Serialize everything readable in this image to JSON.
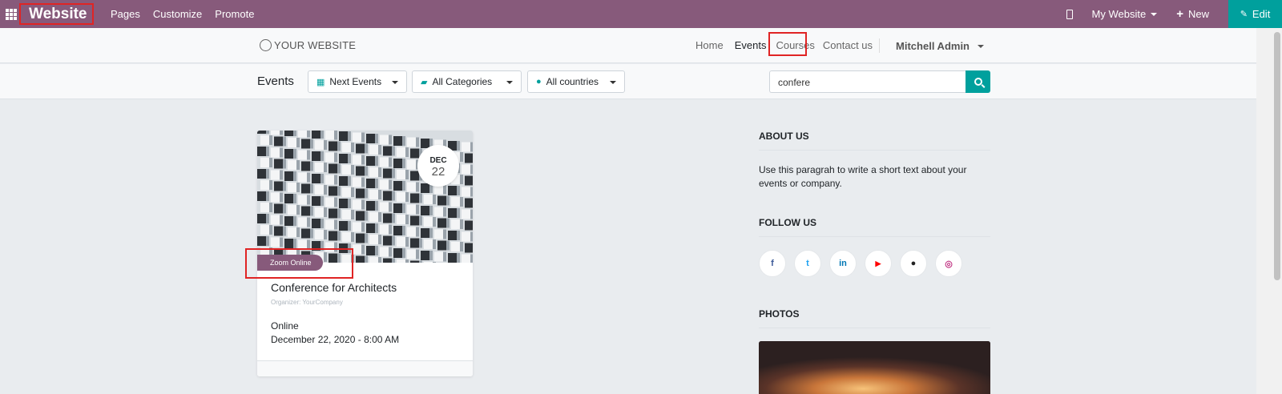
{
  "topbar": {
    "app_name": "Website",
    "menu": [
      "Pages",
      "Customize",
      "Promote"
    ],
    "my_website": "My Website",
    "new_label": "New",
    "edit_label": "Edit",
    "color": "#875a7b"
  },
  "navbar": {
    "logo": "YOUR WEBSITE",
    "links": [
      "Home",
      "Events",
      "Courses",
      "Contact us"
    ],
    "user": "Mitchell Admin"
  },
  "filters": {
    "title": "Events",
    "next_events": "Next Events",
    "categories": "All Categories",
    "countries": "All countries",
    "search_value": "confere"
  },
  "event": {
    "month": "DEC",
    "day": "22",
    "tag": "Zoom Online",
    "title": "Conference for Architects",
    "organizer": "Organizer: YourCompany",
    "location": "Online",
    "datetime": "December 22, 2020 - 8:00 AM"
  },
  "sidebar": {
    "about_title": "ABOUT US",
    "about_text": "Use this paragrah to write a short text about your events or company.",
    "follow_title": "FOLLOW US",
    "photos_title": "PHOTOS",
    "socials": [
      {
        "icon": "facebook-icon",
        "glyph": "f",
        "color": "#3b5998"
      },
      {
        "icon": "twitter-icon",
        "glyph": "t",
        "color": "#1da1f2"
      },
      {
        "icon": "linkedin-icon",
        "glyph": "in",
        "color": "#0077b5"
      },
      {
        "icon": "youtube-icon",
        "glyph": "▶",
        "color": "#ff0000"
      },
      {
        "icon": "github-icon",
        "glyph": "●",
        "color": "#222222"
      },
      {
        "icon": "instagram-icon",
        "glyph": "◎",
        "color": "#c13584"
      }
    ]
  },
  "accent": "#00a09d"
}
